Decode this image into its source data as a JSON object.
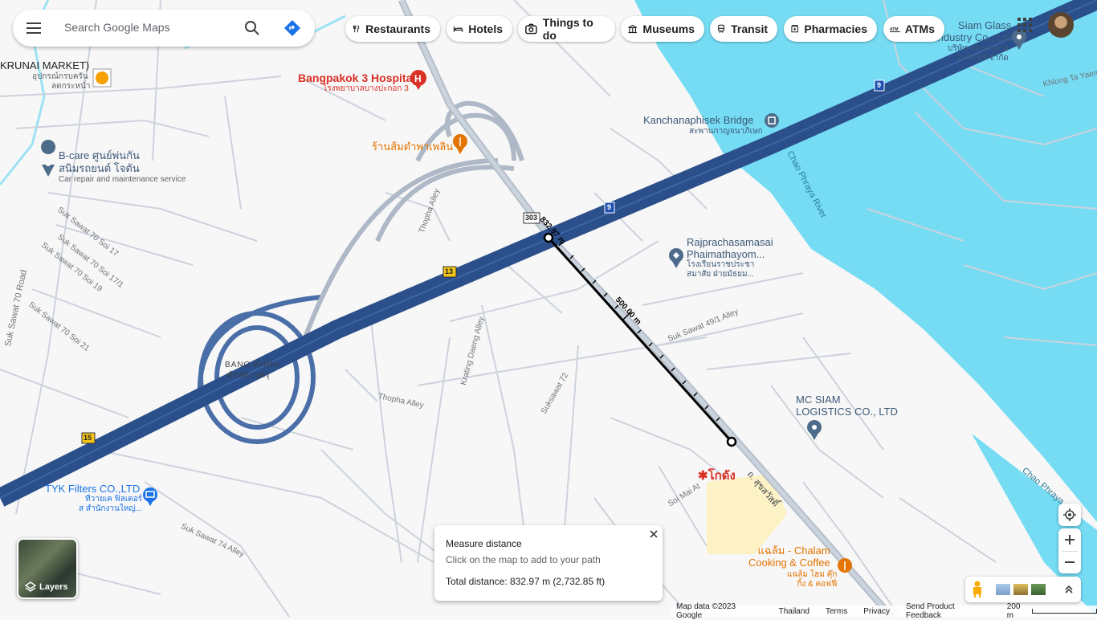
{
  "search": {
    "placeholder": "Search Google Maps"
  },
  "chips": [
    {
      "label": "Restaurants",
      "icon": "fork-knife-icon"
    },
    {
      "label": "Hotels",
      "icon": "bed-icon"
    },
    {
      "label": "Things to do",
      "icon": "camera-icon"
    },
    {
      "label": "Museums",
      "icon": "museum-icon"
    },
    {
      "label": "Transit",
      "icon": "train-icon"
    },
    {
      "label": "Pharmacies",
      "icon": "pharmacy-icon"
    },
    {
      "label": "ATMs",
      "icon": "atm-icon"
    }
  ],
  "places": {
    "krunai": "KRUNAI MARKET)",
    "krunai_th1": "อุปกรณ์กรบครัน",
    "krunai_th2": "ลดกระหน่ำ",
    "hospital": "Bangpakok 3 Hospital",
    "hospital_th": "โรงพยาบาลบางปะกอก 3",
    "restaurant_th": "ร้านส้มตำพาเพลิน",
    "bcare1": "B-care ศูนย์พ่นกัน",
    "bcare2": "สนิมรถยนต์ โจตัน",
    "bcare_sub": "Car repair and maintenance service",
    "bridge": "Kanchanaphisek Bridge",
    "bridge_th": "สะพานกาญจนาภิเษก",
    "siam_glass1": "Siam Glass",
    "siam_glass2": "Industry Co., Ltd",
    "siam_glass_th1": "บริษัท สยามกลาส",
    "siam_glass_th2": "อินดัสทรี จำกัด",
    "khlong": "Khlong Ta Yaem",
    "river1": "Chao Phraya River",
    "river2": "Chao Phraya",
    "school1": "Rajprachasamasai",
    "school2": "Phaimathayom...",
    "school_th1": "โรงเรียนราชประชา",
    "school_th2": "สมาสัย ฝ่ายมัธยม...",
    "mcsiam1": "MC SIAM",
    "mcsiam2": "LOGISTICS CO., LTD",
    "bangkhru": "BANG KHRU",
    "bangkhru_th": "ตำบลบางครุ",
    "tyk": "TYK Filters CO.,LTD",
    "tyk_th1": "ทีวายเค ฟิลเตอร์",
    "tyk_th2": "ส สำนักงานใหญ่...",
    "khodang": "✱โกดัง",
    "chalam1": "แฉล้ม - Chalam",
    "chalam2": "Cooking & Coffee",
    "chalam_th1": "แฉล้ม โฮม คุ๊ก",
    "chalam_th2": "กิ้ง & คอฟฟี่"
  },
  "streets": {
    "s1": "Suk Sawat 70 Soi 17",
    "s2": "Suk Sawat 70 Soi 17/1",
    "s3": "Suk Sawat 70 Soi 19",
    "s4": "Suk Sawat 70 Soi 21",
    "s5": "Suk Sawat 70 Road",
    "s6": "Thopha Alley",
    "s7": "Thopha Alley",
    "s8": "Krating Daeng Alley",
    "s9": "Suksawat 72",
    "s10": "Suk Sawat 49/1 Alley",
    "s11": "Suk Sawat 74 Alley",
    "s12": "Soi Mai At",
    "s13": "ถ. สุขสวัสดิ์"
  },
  "shields": {
    "r9a": "9",
    "r9b": "9",
    "r13": "13",
    "r15": "15",
    "r303": "303"
  },
  "measure": {
    "seg_label": "832.97 m",
    "mid_label": "500.00 m",
    "title": "Measure distance",
    "hint": "Click on the map to add to your path",
    "total": "Total distance: 832.97 m (2,732.85 ft)"
  },
  "layers": {
    "label": "Layers"
  },
  "footer": {
    "mapdata": "Map data ©2023 Google",
    "country": "Thailand",
    "terms": "Terms",
    "privacy": "Privacy",
    "feedback": "Send Product Feedback",
    "scale": "200 m"
  },
  "colors": {
    "highway": "#2b4f8a",
    "river": "#75dcf4",
    "road": "#ccd3dc",
    "poi_blue": "#1a73e8",
    "red": "#d93025",
    "orange": "#e37400"
  }
}
